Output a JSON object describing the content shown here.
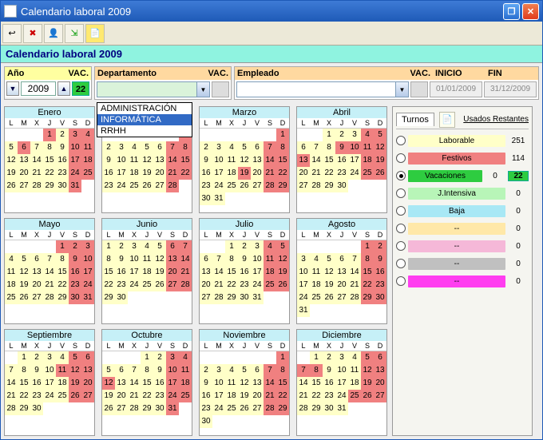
{
  "window": {
    "title": "Calendario laboral 2009"
  },
  "header": "Calendario laboral 2009",
  "filters": {
    "ano_label": "Año",
    "vac_label": "VAC.",
    "year": "2009",
    "vac": "22",
    "dept_label": "Departamento",
    "emp_label": "Empleado",
    "inicio_label": "INICIO",
    "fin_label": "FIN",
    "inicio": "01/01/2009",
    "fin": "31/12/2009",
    "dept_options": [
      "ADMINISTRACIÓN",
      "INFORMÁTICA",
      "RRHH"
    ],
    "dept_selected_index": 1
  },
  "dow": [
    "L",
    "M",
    "X",
    "J",
    "V",
    "S",
    "D"
  ],
  "months": [
    {
      "name": "Enero",
      "offset": 3,
      "days": 31,
      "red": [
        1,
        3,
        4,
        6,
        10,
        11,
        17,
        18,
        24,
        25,
        31
      ]
    },
    {
      "name": "Febrero",
      "offset": 6,
      "days": 28,
      "red": [
        1,
        7,
        8,
        14,
        15,
        21,
        22,
        28
      ]
    },
    {
      "name": "Marzo",
      "offset": 6,
      "days": 31,
      "red": [
        1,
        7,
        8,
        14,
        15,
        19,
        21,
        22,
        28,
        29
      ]
    },
    {
      "name": "Abril",
      "offset": 2,
      "days": 30,
      "red": [
        4,
        5,
        9,
        10,
        11,
        12,
        13,
        18,
        19,
        25,
        26
      ]
    },
    {
      "name": "Mayo",
      "offset": 4,
      "days": 31,
      "red": [
        1,
        2,
        3,
        9,
        10,
        16,
        17,
        23,
        24,
        30,
        31
      ]
    },
    {
      "name": "Junio",
      "offset": 0,
      "days": 30,
      "red": [
        6,
        7,
        13,
        14,
        20,
        21,
        27,
        28
      ]
    },
    {
      "name": "Julio",
      "offset": 2,
      "days": 31,
      "red": [
        4,
        5,
        11,
        12,
        18,
        19,
        25,
        26
      ]
    },
    {
      "name": "Agosto",
      "offset": 5,
      "days": 31,
      "red": [
        1,
        2,
        8,
        9,
        15,
        16,
        22,
        23,
        29,
        30
      ]
    },
    {
      "name": "Septiembre",
      "offset": 1,
      "days": 30,
      "red": [
        5,
        6,
        11,
        12,
        13,
        19,
        20,
        26,
        27
      ]
    },
    {
      "name": "Octubre",
      "offset": 3,
      "days": 31,
      "red": [
        3,
        4,
        10,
        11,
        12,
        17,
        18,
        24,
        25,
        31
      ]
    },
    {
      "name": "Noviembre",
      "offset": 6,
      "days": 30,
      "red": [
        1,
        7,
        8,
        14,
        15,
        21,
        22,
        28,
        29
      ]
    },
    {
      "name": "Diciembre",
      "offset": 1,
      "days": 31,
      "red": [
        5,
        6,
        7,
        8,
        12,
        13,
        19,
        20,
        25,
        26,
        27
      ]
    }
  ],
  "turnos": {
    "tab": "Turnos",
    "cols": "Usados Restantes",
    "rows": [
      {
        "label": "Laborable",
        "color": "#ffffc8",
        "used": "251",
        "rest": "",
        "on": false
      },
      {
        "label": "Festivos",
        "color": "#f08080",
        "used": "114",
        "rest": "",
        "on": false
      },
      {
        "label": "Vacaciones",
        "color": "#2ecc40",
        "used": "0",
        "rest": "22",
        "on": true
      },
      {
        "label": "J.Intensiva",
        "color": "#b8f5b8",
        "used": "0",
        "rest": "",
        "on": false
      },
      {
        "label": "Baja",
        "color": "#a8e8f5",
        "used": "0",
        "rest": "",
        "on": false
      },
      {
        "label": "--",
        "color": "#ffe8a8",
        "used": "0",
        "rest": "",
        "on": false
      },
      {
        "label": "--",
        "color": "#f5b8d8",
        "used": "0",
        "rest": "",
        "on": false
      },
      {
        "label": "--",
        "color": "#c0c0c0",
        "used": "0",
        "rest": "",
        "on": false
      },
      {
        "label": "--",
        "color": "#ff3ef0",
        "used": "0",
        "rest": "",
        "on": false
      }
    ]
  }
}
